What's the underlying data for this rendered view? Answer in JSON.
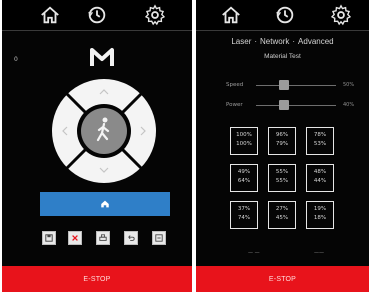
{
  "left_screen": {
    "nav": {
      "home_icon": "home-icon",
      "history_icon": "history-icon",
      "settings_icon": "gear-icon"
    },
    "small_value": "0",
    "dpad": {
      "center_icon": "walking-person-icon",
      "arrows": [
        "up",
        "right",
        "down",
        "left"
      ]
    },
    "home_button_icon": "home-icon",
    "tools": [
      "save-icon",
      "clear-icon",
      "print-icon",
      "undo-icon",
      "export-icon"
    ],
    "estop_label": "E-STOP"
  },
  "right_screen": {
    "nav": {
      "home_icon": "home-icon",
      "history_icon": "history-icon",
      "settings_icon": "gear-icon"
    },
    "tabs": [
      "Laser",
      "Network",
      "Advanced"
    ],
    "subtitle": "Material Test",
    "sliders": [
      {
        "label": "Speed",
        "value_text": "50%",
        "level": 0.35
      },
      {
        "label": "Power",
        "value_text": "40%",
        "level": 0.35
      }
    ],
    "grid": [
      [
        {
          "a": "100%",
          "b": "100%"
        },
        {
          "a": "96%",
          "b": "79%"
        },
        {
          "a": "78%",
          "b": "53%"
        }
      ],
      [
        {
          "a": "49%",
          "b": "64%"
        },
        {
          "a": "55%",
          "b": "55%"
        },
        {
          "a": "48%",
          "b": "44%"
        }
      ],
      [
        {
          "a": "37%",
          "b": "74%"
        },
        {
          "a": "27%",
          "b": "45%"
        },
        {
          "a": "19%",
          "b": "18%"
        }
      ]
    ],
    "footer_left": "— —",
    "footer_right": "——",
    "estop_label": "E-STOP"
  },
  "colors": {
    "estop": "#e8131b",
    "accent_blue": "#2f7fc8",
    "background": "#050505"
  }
}
